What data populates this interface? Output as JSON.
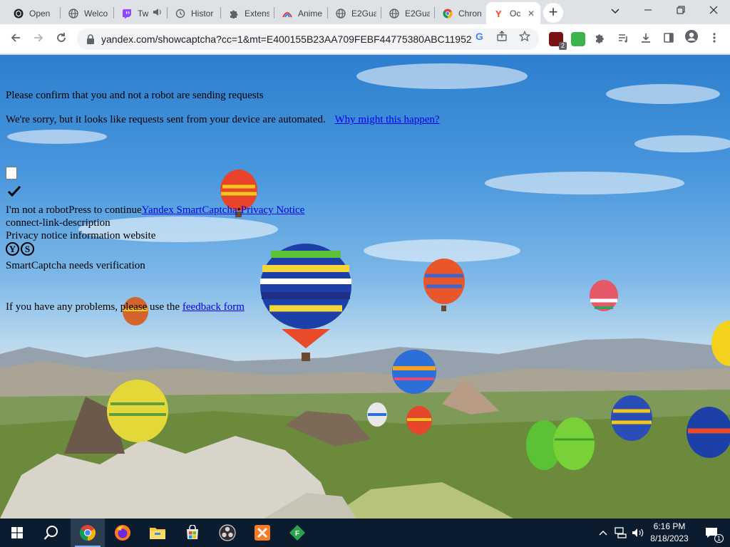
{
  "browser": {
    "tabs": [
      {
        "title": "Open",
        "icon": "openai-icon",
        "active": false
      },
      {
        "title": "Welco",
        "icon": "globe-icon",
        "active": false
      },
      {
        "title": "Tw",
        "icon": "twitch-icon",
        "active": false,
        "audio": true
      },
      {
        "title": "Histor",
        "icon": "history-icon",
        "active": false
      },
      {
        "title": "Extens",
        "icon": "puzzle-icon",
        "active": false
      },
      {
        "title": "Anime",
        "icon": "anime-site-icon",
        "active": false
      },
      {
        "title": "E2Gua",
        "icon": "globe-icon",
        "active": false
      },
      {
        "title": "E2Gua",
        "icon": "globe-icon",
        "active": false
      },
      {
        "title": "Chron",
        "icon": "chrome-icon",
        "active": false
      },
      {
        "title": "Oc",
        "icon": "yandex-icon",
        "active": true
      }
    ],
    "new_tab_label": "+",
    "url": "yandex.com/showcaptcha?cc=1&mt=E400155B23AA709FEBF44775380ABC11952...",
    "extension_badge": "2"
  },
  "page": {
    "heading": "Please confirm that you and not a robot are sending requests",
    "sorry_text": "We're sorry, but it looks like requests sent from your device are automated.",
    "why_link": "Why might this happen?",
    "captcha": {
      "not_robot": "I'm not a robot",
      "press_continue": "Press to continue",
      "smartcaptcha_link": "Yandex SmartCaptcha",
      "separator": "•",
      "privacy_link": "Privacy Notice",
      "connect_desc": "connect-link-description",
      "privacy_info": "Privacy notice information website",
      "logo_y": "Y",
      "logo_s": "S",
      "needs_verification": "SmartCaptcha needs verification"
    },
    "feedback_prefix": "If you have any problems, please use the",
    "feedback_link": "feedback form"
  },
  "taskbar": {
    "time": "6:16 PM",
    "date": "8/18/2023",
    "notification_count": "1"
  },
  "colors": {
    "link": "#0000ee",
    "chrome_tab_bg": "#dee1e6",
    "taskbar_bg": "#0c1c2f"
  }
}
